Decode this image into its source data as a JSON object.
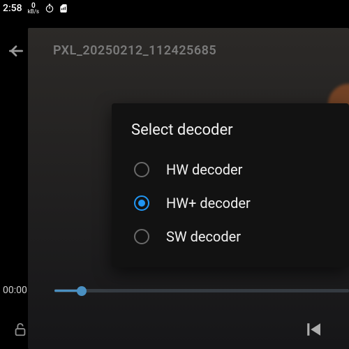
{
  "status": {
    "time": "2:58",
    "speed_value": "0",
    "speed_unit": "kB/s"
  },
  "player": {
    "video_title": "PXL_20250212_112425685",
    "current_time": "00:00"
  },
  "dialog": {
    "title": "Select decoder",
    "options": [
      {
        "label": "HW decoder",
        "selected": false
      },
      {
        "label": "HW+ decoder",
        "selected": true
      },
      {
        "label": "SW decoder",
        "selected": false
      }
    ]
  }
}
